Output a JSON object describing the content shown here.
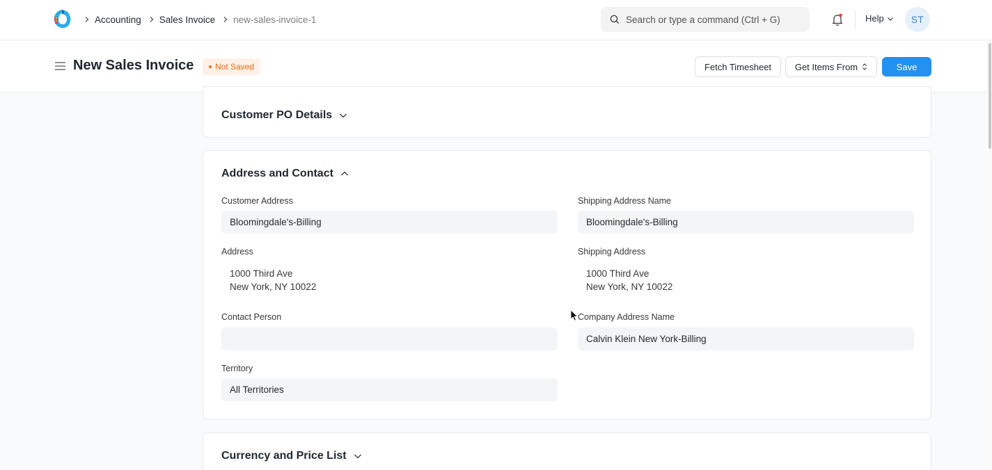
{
  "breadcrumbs": {
    "items": [
      "Accounting",
      "Sales Invoice"
    ],
    "current": "new-sales-invoice-1"
  },
  "search": {
    "placeholder": "Search or type a command (Ctrl + G)"
  },
  "navbar": {
    "help_label": "Help",
    "avatar_initials": "ST"
  },
  "page": {
    "title": "New Sales Invoice",
    "status": "Not Saved",
    "actions": {
      "fetch_timesheet": "Fetch Timesheet",
      "get_items_from": "Get Items From",
      "save": "Save"
    }
  },
  "sections": {
    "customer_po": {
      "title": "Customer PO Details",
      "expanded": false
    },
    "address_contact": {
      "title": "Address and Contact",
      "expanded": true,
      "fields": {
        "customer_address": {
          "label": "Customer Address",
          "value": "Bloomingdale's-Billing"
        },
        "address": {
          "label": "Address",
          "line1": "1000 Third Ave",
          "line2": "New York, NY 10022"
        },
        "contact_person": {
          "label": "Contact Person",
          "value": ""
        },
        "territory": {
          "label": "Territory",
          "value": "All Territories"
        },
        "shipping_address_name": {
          "label": "Shipping Address Name",
          "value": "Bloomingdale's-Billing"
        },
        "shipping_address": {
          "label": "Shipping Address",
          "line1": "1000 Third Ave",
          "line2": "New York, NY 10022"
        },
        "company_address_name": {
          "label": "Company Address Name",
          "value": "Calvin Klein New York-Billing"
        }
      }
    },
    "currency_price_list": {
      "title": "Currency and Price List",
      "expanded": false
    }
  },
  "colors": {
    "primary": "#2490ef",
    "status_orange": "#e86c13",
    "status_bg": "#fff1e7",
    "input_bg": "#f4f5f6"
  },
  "icons": [
    "app-logo-icon",
    "chevron-right-icon",
    "search-icon",
    "bell-icon",
    "chevron-down-icon",
    "hamburger-icon",
    "sort-icon",
    "chevron-up-icon"
  ]
}
